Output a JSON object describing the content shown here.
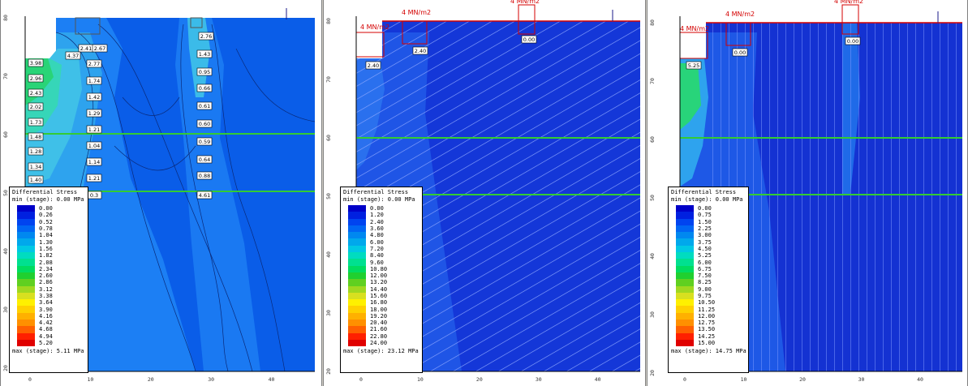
{
  "panels": [
    {
      "id": "p1",
      "legend": {
        "title": "Differential Stress",
        "min": "min (stage): 0.00 MPa",
        "max": "max (stage): 5.11 MPa",
        "levels": [
          "0.00",
          "0.26",
          "0.52",
          "0.78",
          "1.04",
          "1.30",
          "1.56",
          "1.82",
          "2.08",
          "2.34",
          "2.60",
          "2.86",
          "3.12",
          "3.38",
          "3.64",
          "3.90",
          "4.16",
          "4.42",
          "4.68",
          "4.94",
          "5.20"
        ]
      },
      "xticks": [
        "0",
        "10",
        "20",
        "30",
        "40"
      ],
      "yticks": [
        "80",
        "70",
        "60",
        "50",
        "40",
        "30",
        "20"
      ],
      "labels": [
        "3.98",
        "2.96",
        "2.43",
        "2.02",
        "1.73",
        "1.48",
        "1.28",
        "1.34",
        "1.40",
        "2.41",
        "2.67",
        "2.77",
        "1.74",
        "1.42",
        "1.29",
        "1.21",
        "1.04",
        "1.14",
        "1.21",
        "4.37",
        "2.76",
        "1.43",
        "0.95",
        "0.66",
        "0.61",
        "0.60",
        "0.59",
        "0.64",
        "0.88",
        "4.61",
        "0.3"
      ]
    },
    {
      "id": "p2",
      "legend": {
        "title": "Differential Stress",
        "min": "min (stage): 0.00 MPa",
        "max": "max (stage): 23.12 MPa",
        "levels": [
          "0.00",
          "1.20",
          "2.40",
          "3.60",
          "4.80",
          "6.00",
          "7.20",
          "8.40",
          "9.60",
          "10.80",
          "12.00",
          "13.20",
          "14.40",
          "15.60",
          "16.80",
          "18.00",
          "19.20",
          "20.40",
          "21.60",
          "22.80",
          "24.00"
        ]
      },
      "xticks": [
        "0",
        "10",
        "20",
        "30",
        "40"
      ],
      "yticks": [
        "80",
        "70",
        "60",
        "50",
        "40",
        "30",
        "20"
      ],
      "loads": [
        "4 MN/m2",
        "4 MN/m2",
        "4 MN/m2"
      ],
      "labels": [
        "2.40",
        "2.40",
        "0.00"
      ]
    },
    {
      "id": "p3",
      "legend": {
        "title": "Differential Stress",
        "min": "min (stage): 0.00 MPa",
        "max": "max (stage): 14.75 MPa",
        "levels": [
          "0.00",
          "0.75",
          "1.50",
          "2.25",
          "3.00",
          "3.75",
          "4.50",
          "5.25",
          "6.00",
          "6.75",
          "7.50",
          "8.25",
          "9.00",
          "9.75",
          "10.50",
          "11.25",
          "12.00",
          "12.75",
          "13.50",
          "14.25",
          "15.00"
        ]
      },
      "xticks": [
        "0",
        "10",
        "20",
        "30",
        "40"
      ],
      "yticks": [
        "80",
        "70",
        "60",
        "50",
        "40",
        "30",
        "20"
      ],
      "loads": [
        "4 MN/m2",
        "4 MN/m2",
        "4 MN/m2"
      ],
      "labels": [
        "5.25",
        "0.00",
        "0.00"
      ]
    }
  ],
  "colors": [
    "#0000c8",
    "#0020e0",
    "#0044f0",
    "#0066f4",
    "#0088f0",
    "#00a8ec",
    "#00c8e4",
    "#00dcc0",
    "#00e090",
    "#00dc60",
    "#20d030",
    "#60d020",
    "#a0d820",
    "#d8e020",
    "#fff000",
    "#ffd000",
    "#ffb000",
    "#ff9000",
    "#ff6000",
    "#ff2000",
    "#e00000"
  ],
  "accent": {
    "green_line": "#33cc33",
    "load": "#d40000"
  }
}
